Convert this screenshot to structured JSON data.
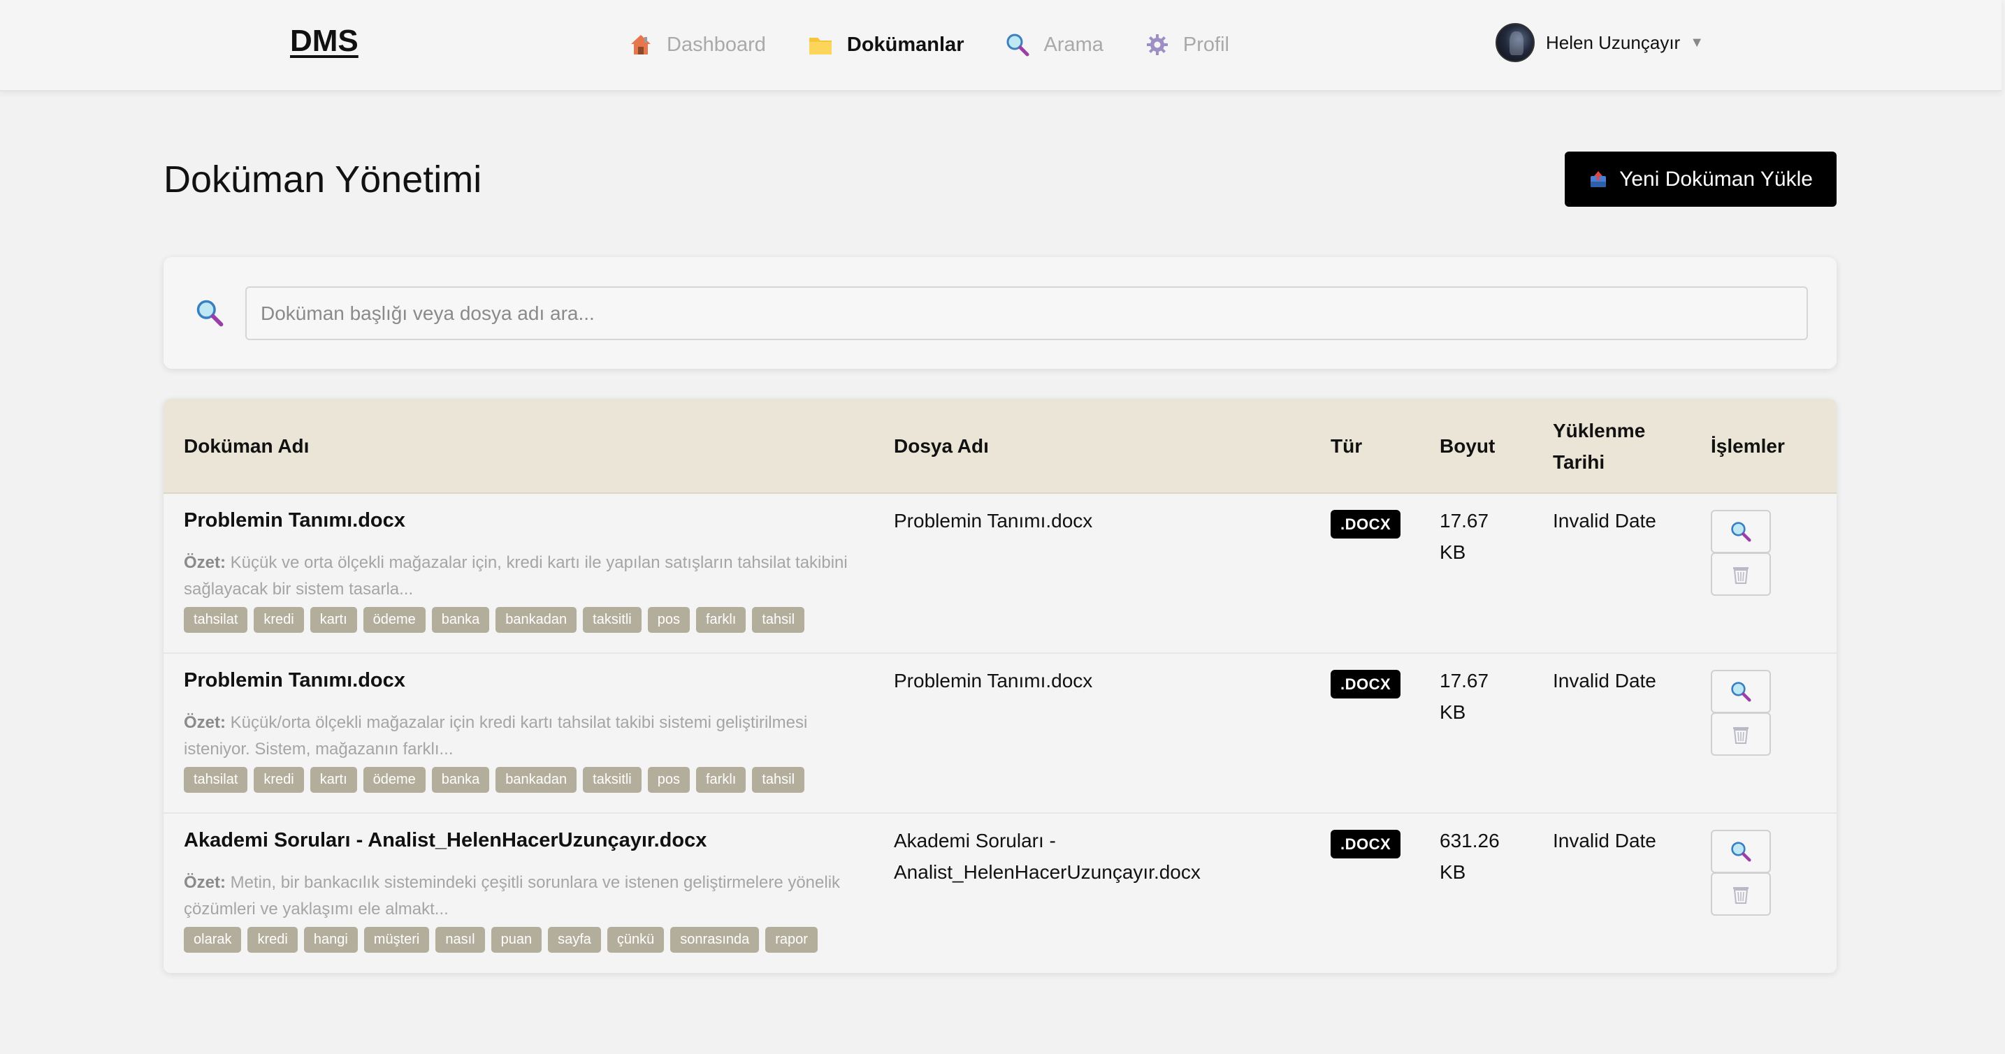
{
  "nav": {
    "logo": "DMS",
    "items": [
      {
        "label": "Dashboard",
        "icon": "house-icon",
        "active": false
      },
      {
        "label": "Dokümanlar",
        "icon": "folder-icon",
        "active": true
      },
      {
        "label": "Arama",
        "icon": "magnifier-icon",
        "active": false
      },
      {
        "label": "Profil",
        "icon": "gear-icon",
        "active": false
      }
    ],
    "user": {
      "name": "Helen Uzunçayır",
      "dropdown_glyph": "▼"
    }
  },
  "page": {
    "title": "Doküman Yönetimi",
    "upload_button": "Yeni Doküman Yükle"
  },
  "search": {
    "placeholder": "Doküman başlığı veya dosya adı ara...",
    "value": ""
  },
  "table": {
    "columns": [
      "Doküman Adı",
      "Dosya Adı",
      "Tür",
      "Boyut",
      "Yüklenme Tarihi",
      "İşlemler"
    ],
    "summary_label": "Özet:",
    "rows": [
      {
        "title": "Problemin Tanımı.docx",
        "summary": "Küçük ve orta ölçekli mağazalar için, kredi kartı ile yapılan satışların tahsilat takibini sağlayacak bir sistem tasarla...",
        "tags": [
          "tahsilat",
          "kredi",
          "kartı",
          "ödeme",
          "banka",
          "bankadan",
          "taksitli",
          "pos",
          "farklı",
          "tahsil"
        ],
        "file_name": "Problemin Tanımı.docx",
        "type": ".DOCX",
        "size": "17.67 KB",
        "uploaded": "Invalid Date"
      },
      {
        "title": "Problemin Tanımı.docx",
        "summary": "Küçük/orta ölçekli mağazalar için kredi kartı tahsilat takibi sistemi geliştirilmesi isteniyor. Sistem, mağazanın farklı...",
        "tags": [
          "tahsilat",
          "kredi",
          "kartı",
          "ödeme",
          "banka",
          "bankadan",
          "taksitli",
          "pos",
          "farklı",
          "tahsil"
        ],
        "file_name": "Problemin Tanımı.docx",
        "type": ".DOCX",
        "size": "17.67 KB",
        "uploaded": "Invalid Date"
      },
      {
        "title": "Akademi Soruları - Analist_HelenHacerUzunçayır.docx",
        "summary": "Metin, bir bankacılık sistemindeki çeşitli sorunlara ve istenen geliştirmelere yönelik çözümleri ve yaklaşımı ele almakt...",
        "tags": [
          "olarak",
          "kredi",
          "hangi",
          "müşteri",
          "nasıl",
          "puan",
          "sayfa",
          "çünkü",
          "sonrasında",
          "rapor"
        ],
        "file_name": "Akademi Soruları - Analist_HelenHacerUzunçayır.docx",
        "type": ".DOCX",
        "size": "631.26 KB",
        "uploaded": "Invalid Date"
      }
    ]
  },
  "colors": {
    "header_bg": "#ebe5d7",
    "tag_bg": "#b3ad9b",
    "primary_button": "#000000"
  }
}
